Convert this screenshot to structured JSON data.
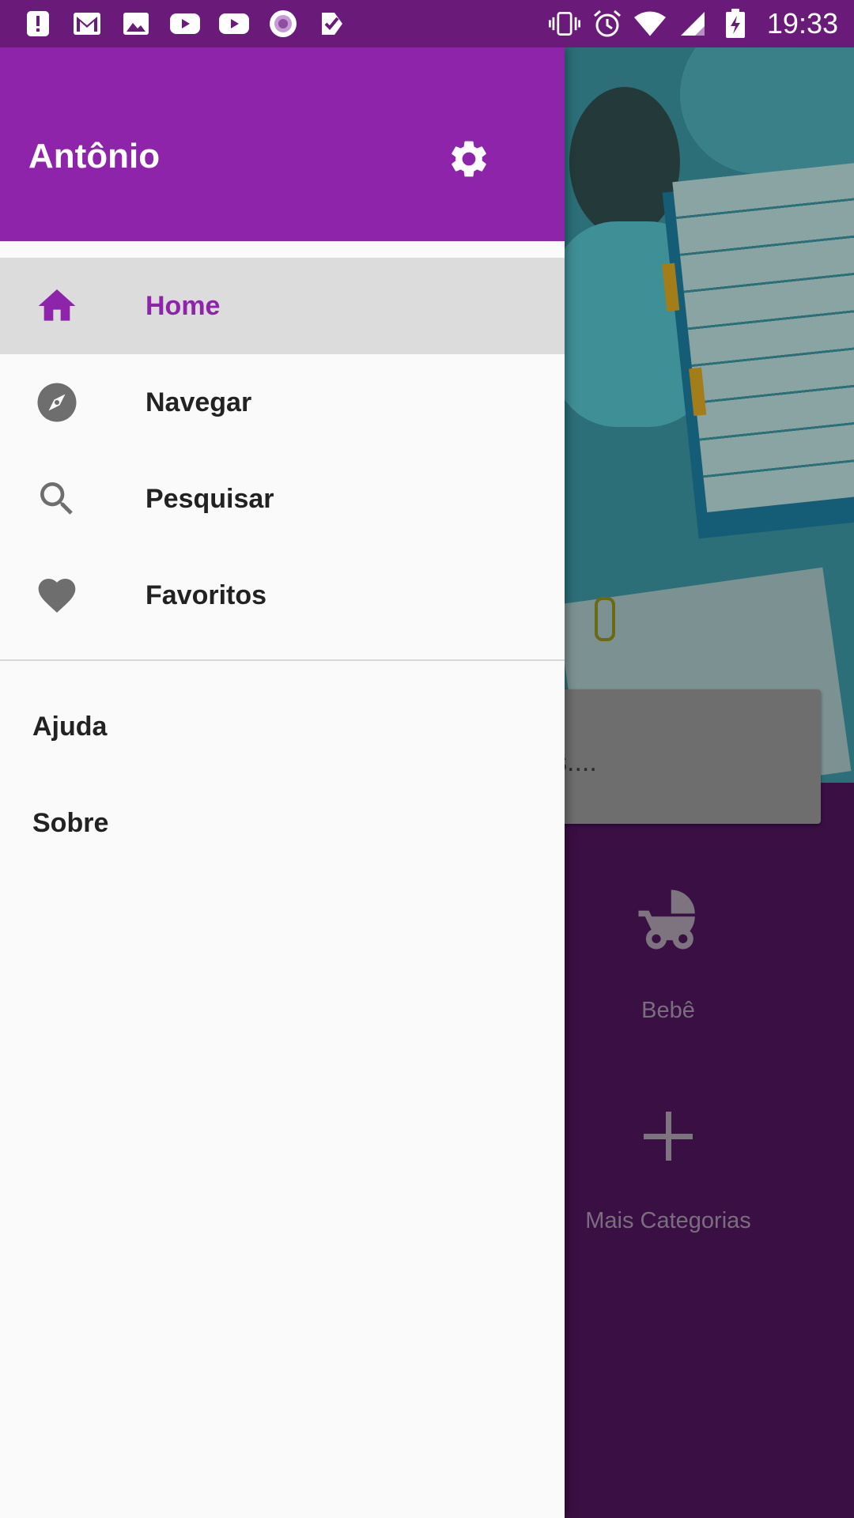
{
  "status_bar": {
    "time": "19:33",
    "left_icons": [
      "alert-icon",
      "gmail-icon",
      "image-icon",
      "youtube-icon",
      "youtube-icon",
      "record-icon",
      "check-tag-icon"
    ],
    "right_icons": [
      "vibrate-icon",
      "alarm-icon",
      "wifi-icon",
      "signal-icon",
      "battery-charging-icon"
    ]
  },
  "drawer": {
    "username": "Antônio",
    "settings_icon": "gear-icon",
    "nav_items": [
      {
        "label": "Home",
        "icon": "home-icon",
        "active": true
      },
      {
        "label": "Navegar",
        "icon": "compass-icon",
        "active": false
      },
      {
        "label": "Pesquisar",
        "icon": "search-icon",
        "active": false
      },
      {
        "label": "Favoritos",
        "icon": "heart-icon",
        "active": false
      }
    ],
    "secondary_items": [
      {
        "label": "Ajuda"
      },
      {
        "label": "Sobre"
      }
    ]
  },
  "background": {
    "search_placeholder_fragment": "s....",
    "categories": [
      {
        "label": "Bebê",
        "icon": "stroller-icon"
      },
      {
        "label": "Mais Categorias",
        "icon": "plus-icon"
      }
    ]
  },
  "colors": {
    "primary": "#8e24aa",
    "status_bar": "#6a1b7a",
    "background_purple": "#3a0f44",
    "active_item_bg": "#dcdcdc"
  }
}
